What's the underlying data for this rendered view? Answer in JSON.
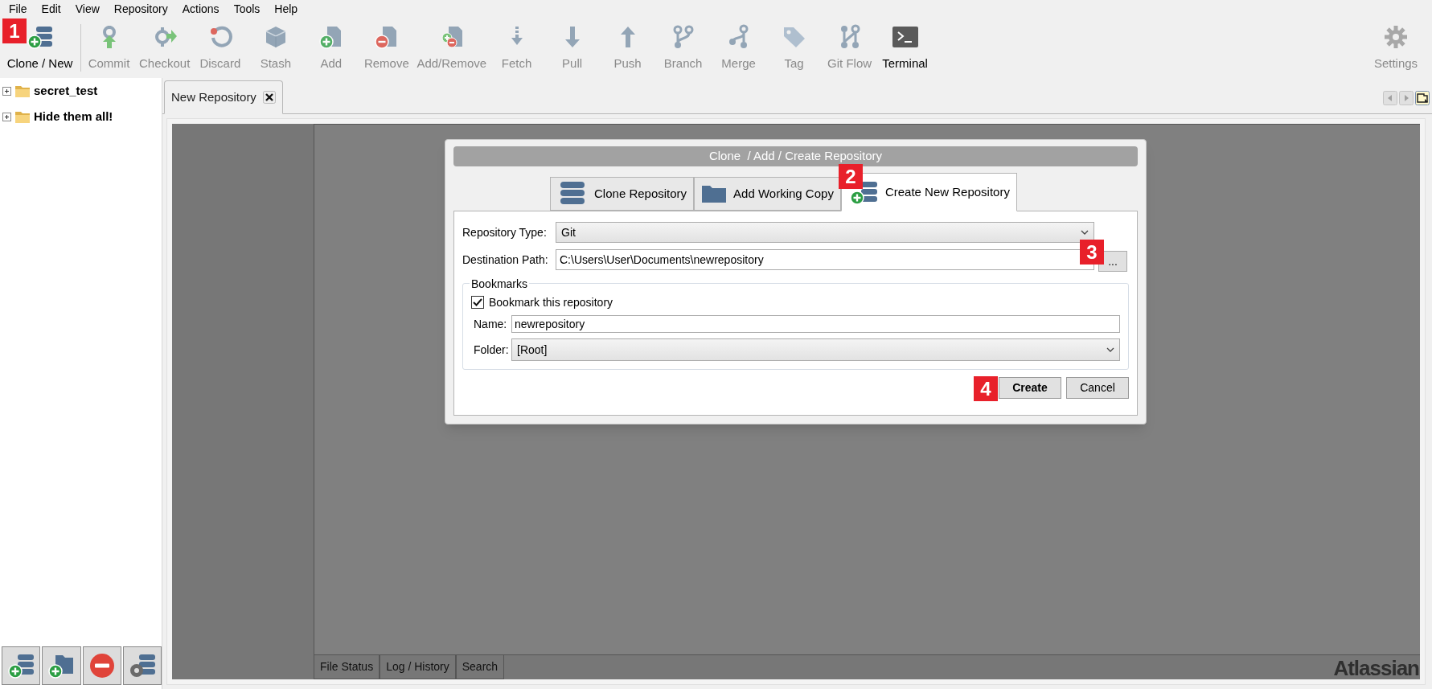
{
  "menu": [
    {
      "label": "File"
    },
    {
      "label": "Edit"
    },
    {
      "label": "View"
    },
    {
      "label": "Repository"
    },
    {
      "label": "Actions"
    },
    {
      "label": "Tools"
    },
    {
      "label": "Help"
    }
  ],
  "toolbar": [
    {
      "label": "Clone / New",
      "disabled": false
    },
    {
      "label": "Commit",
      "disabled": true
    },
    {
      "label": "Checkout",
      "disabled": true
    },
    {
      "label": "Discard",
      "disabled": true
    },
    {
      "label": "Stash",
      "disabled": true
    },
    {
      "label": "Add",
      "disabled": true
    },
    {
      "label": "Remove",
      "disabled": true
    },
    {
      "label": "Add/Remove",
      "disabled": true
    },
    {
      "label": "Fetch",
      "disabled": true
    },
    {
      "label": "Pull",
      "disabled": true
    },
    {
      "label": "Push",
      "disabled": true
    },
    {
      "label": "Branch",
      "disabled": true
    },
    {
      "label": "Merge",
      "disabled": true
    },
    {
      "label": "Tag",
      "disabled": true
    },
    {
      "label": "Git Flow",
      "disabled": true
    },
    {
      "label": "Terminal",
      "disabled": false
    }
  ],
  "settings": {
    "label": "Settings",
    "disabled": true
  },
  "sidebar": {
    "items": [
      {
        "label": "secret_test",
        "expanded": false
      },
      {
        "label": "Hide them all!",
        "expanded": false
      }
    ]
  },
  "tabs": [
    {
      "label": "New Repository",
      "selected": true
    }
  ],
  "dialog": {
    "title": "Clone  / Add / Create Repository",
    "tabs": [
      {
        "label": "Clone Repository",
        "selected": false
      },
      {
        "label": "Add Working Copy",
        "selected": false
      },
      {
        "label": "Create New Repository",
        "selected": true
      }
    ],
    "repository_type_label": "Repository Type:",
    "repository_type": "Git",
    "destination_path_label": "Destination Path:",
    "destination_path": "C:\\Users\\User\\Documents\\newrepository",
    "browse_button": "...",
    "bookmarks": {
      "legend": "Bookmarks",
      "checkbox": {
        "label": "Bookmark this repository",
        "checked": true
      },
      "name_label": "Name:",
      "name": "newrepository",
      "folder_label": "Folder:",
      "folder": "[Root]"
    },
    "buttons": [
      {
        "label": "Create",
        "default": true
      },
      {
        "label": "Cancel",
        "default": false
      }
    ]
  },
  "bottom_tabs": [
    {
      "label": "File Status"
    },
    {
      "label": "Log / History"
    },
    {
      "label": "Search"
    }
  ],
  "brand": "Atlassian",
  "callouts": [
    {
      "label": "1"
    },
    {
      "label": "2"
    },
    {
      "label": "3"
    },
    {
      "label": "4"
    }
  ]
}
